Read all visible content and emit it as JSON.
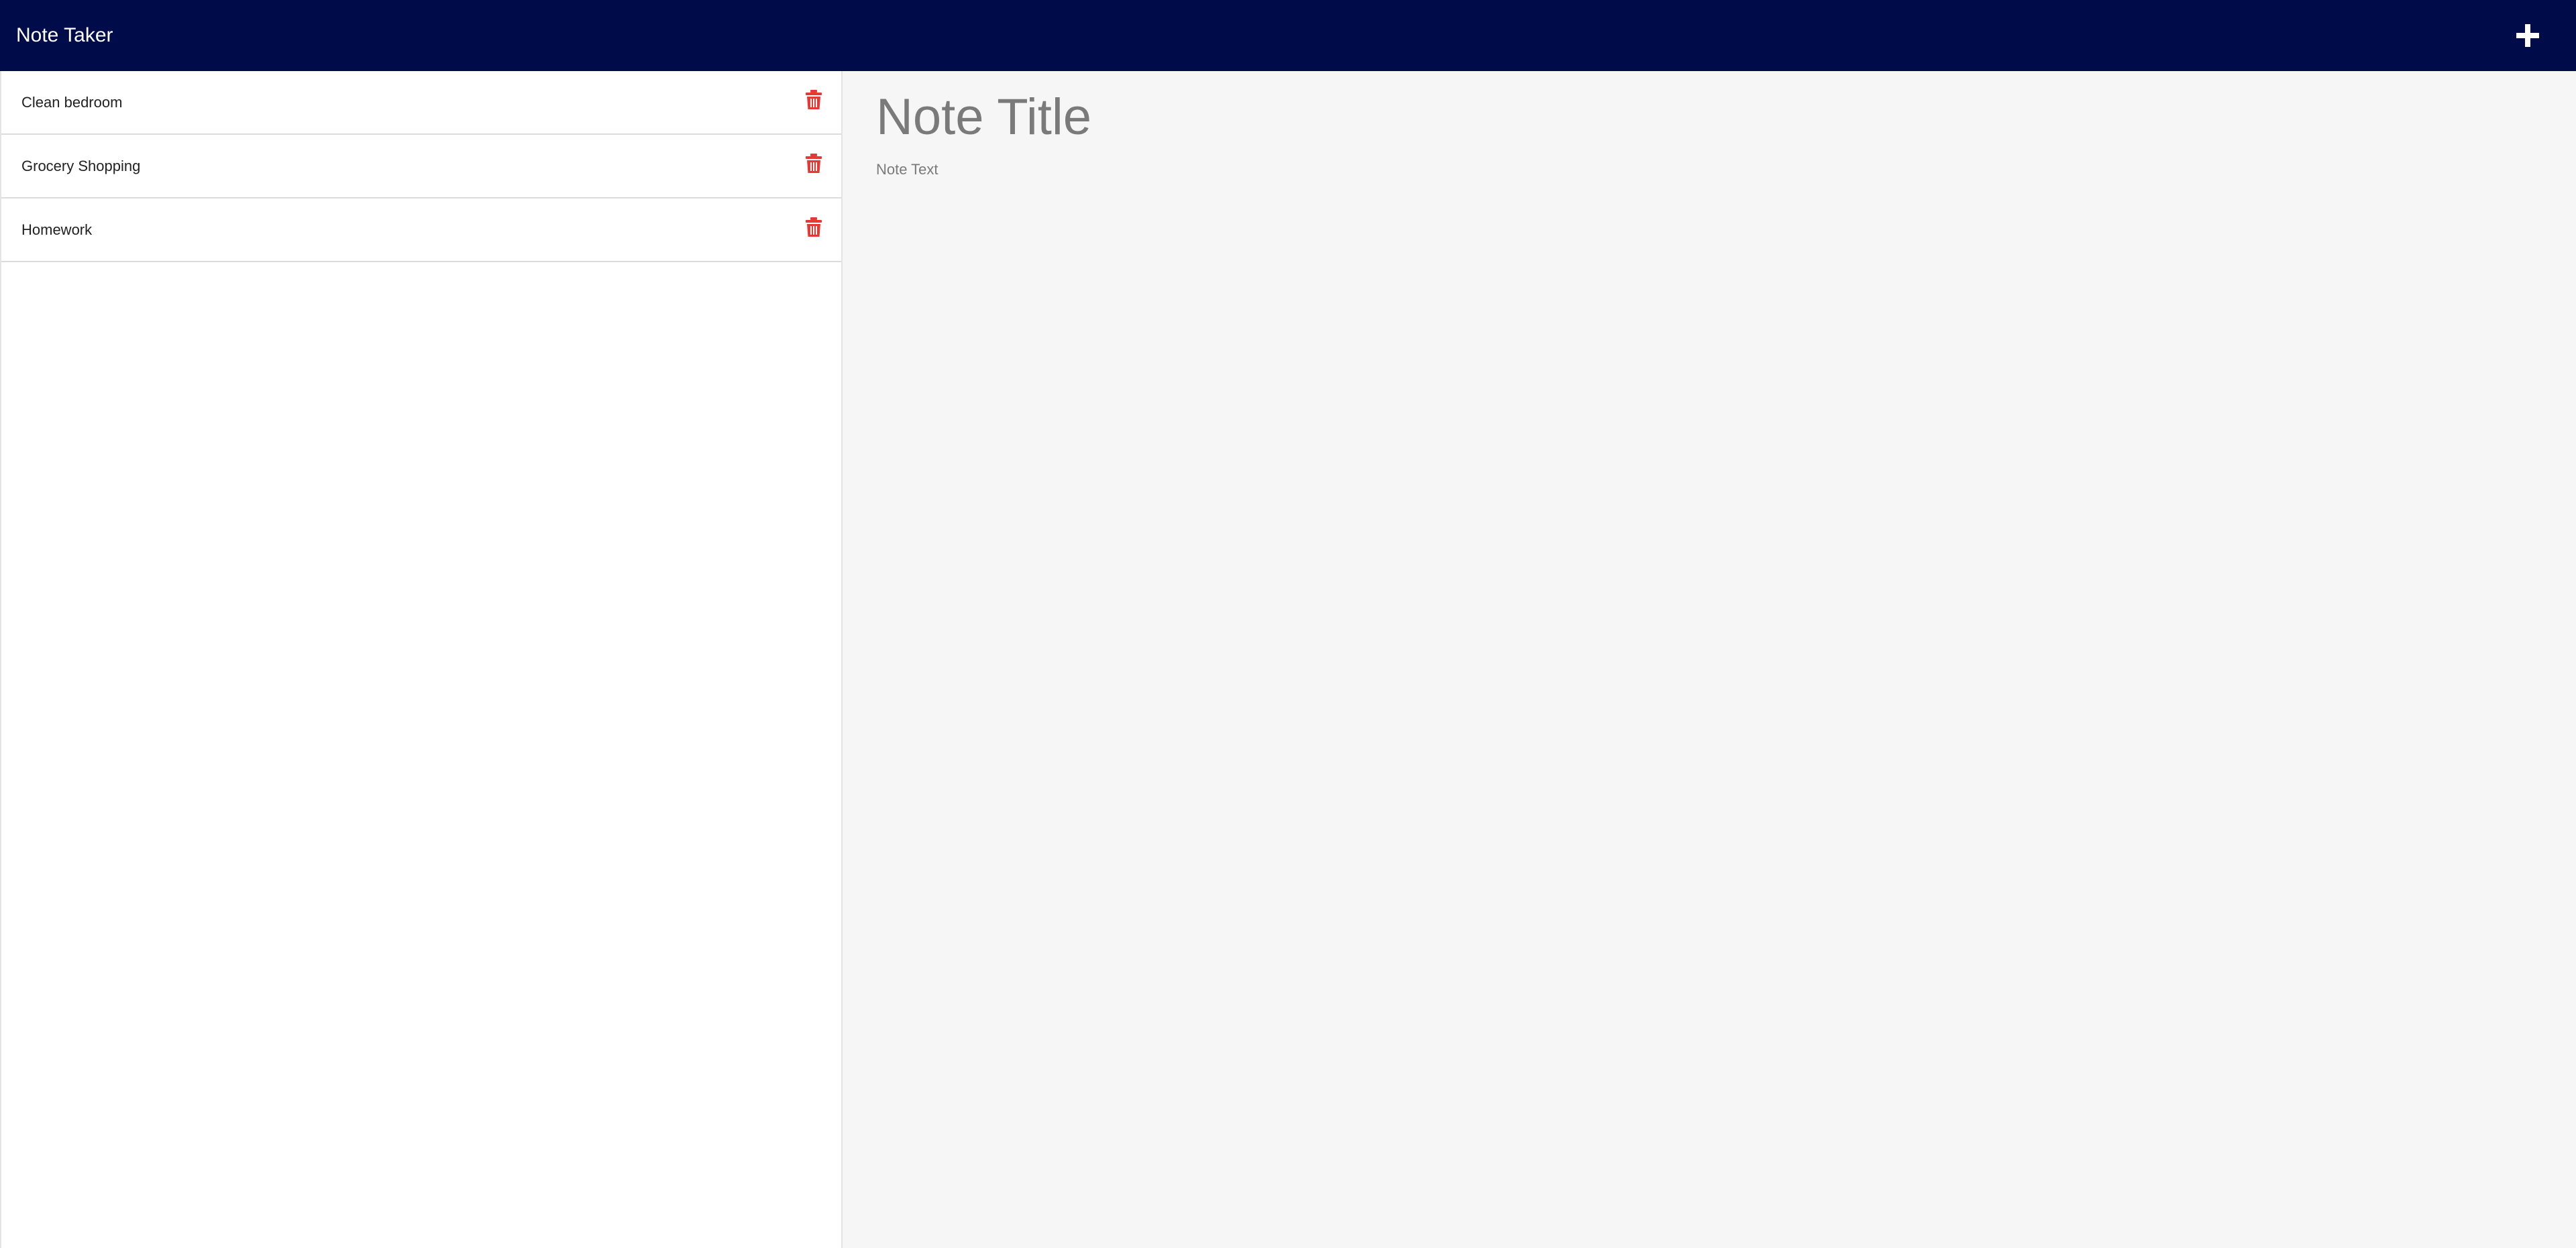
{
  "navbar": {
    "brand": "Note Taker",
    "new_note_icon": "plus-icon"
  },
  "sidebar": {
    "notes": [
      {
        "title": "Clean bedroom",
        "delete_icon": "trash-icon"
      },
      {
        "title": "Grocery Shopping",
        "delete_icon": "trash-icon"
      },
      {
        "title": "Homework",
        "delete_icon": "trash-icon"
      }
    ]
  },
  "editor": {
    "title_placeholder": "Note Title",
    "title_value": "",
    "text_placeholder": "Note Text",
    "text_value": ""
  },
  "colors": {
    "navbar_bg": "#000b4a",
    "delete_icon": "#e53935",
    "editor_bg": "#f6f6f6"
  }
}
